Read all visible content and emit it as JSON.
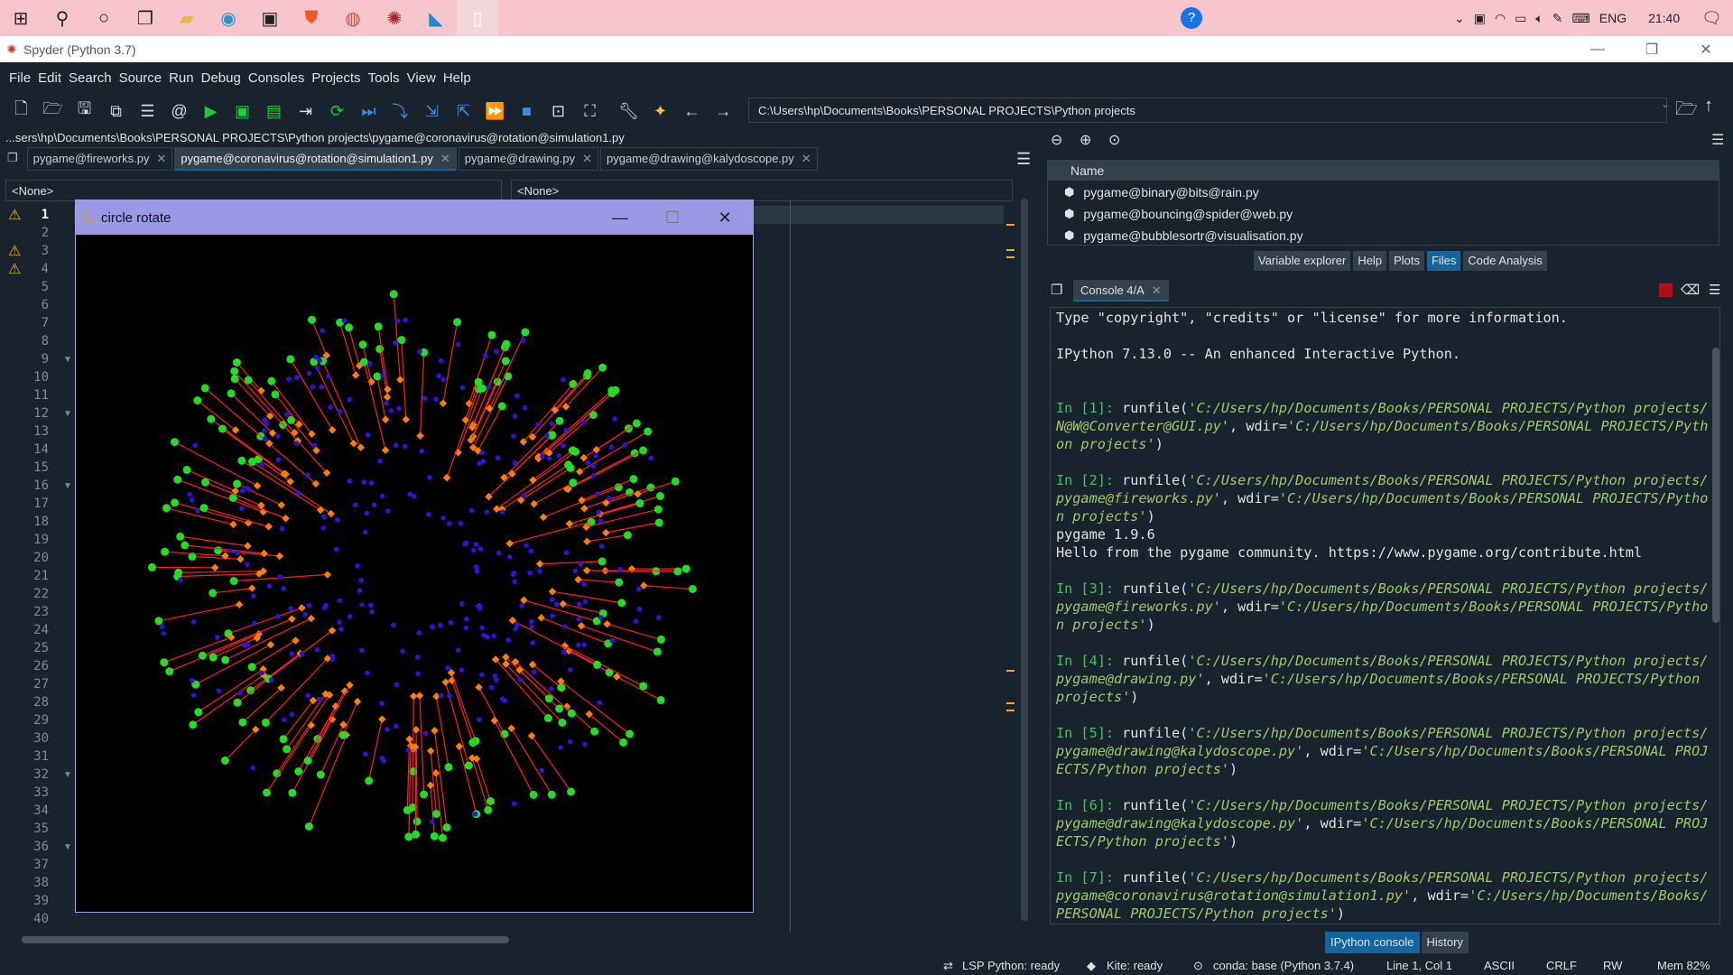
{
  "taskbar": {
    "icons": [
      "windows-start-icon",
      "search-icon",
      "cortana-icon",
      "task-view-icon",
      "file-explorer-icon",
      "edge-icon",
      "store-icon",
      "brave-icon",
      "chrome-icon",
      "spyder-taskbar-icon",
      "vscode-icon",
      "notepad-icon"
    ],
    "language": "ENG",
    "time": "21:40"
  },
  "window": {
    "title": "Spyder (Python 3.7)"
  },
  "menu": [
    "File",
    "Edit",
    "Search",
    "Source",
    "Run",
    "Debug",
    "Consoles",
    "Projects",
    "Tools",
    "View",
    "Help"
  ],
  "toolbar": {
    "working_dir": "C:\\Users\\hp\\Documents\\Books\\PERSONAL PROJECTS\\Python projects"
  },
  "editor": {
    "path": "...sers\\hp\\Documents\\Books\\PERSONAL PROJECTS\\Python projects\\pygame@coronavirus@rotation@simulation1.py",
    "tabs": [
      {
        "label": "pygame@fireworks.py",
        "active": false
      },
      {
        "label": "pygame@coronavirus@rotation@simulation1.py",
        "active": true
      },
      {
        "label": "pygame@drawing.py",
        "active": false
      },
      {
        "label": "pygame@drawing@kalydoscope.py",
        "active": false
      }
    ],
    "class_combo": "<None>",
    "method_combo": "<None>",
    "current_line": 1,
    "line_count": 40,
    "warning_lines": [
      1,
      3,
      4
    ],
    "fold_lines": [
      9,
      12,
      16,
      32,
      36
    ]
  },
  "pygame_window": {
    "title": "circle rotate"
  },
  "files": {
    "header": "Name",
    "items": [
      "pygame@binary@bits@rain.py",
      "pygame@bouncing@spider@web.py",
      "pygame@bubblesortr@visualisation.py"
    ]
  },
  "pane_tabs": [
    "Variable explorer",
    "Help",
    "Plots",
    "Files",
    "Code Analysis"
  ],
  "active_pane_tab": "Files",
  "console": {
    "tab": "Console 4/A",
    "intro1": "Type \"copyright\", \"credits\" or \"license\" for more information.",
    "intro2": "IPython 7.13.0 -- An enhanced Interactive Python.",
    "pygame_version": "pygame 1.9.6",
    "pygame_hello": "Hello from the pygame community. https://www.pygame.org/contribute.html",
    "entries": [
      {
        "prompt": "In [1]:",
        "file": "'C:/Users/hp/Documents/Books/PERSONAL PROJECTS/Python projects/N@W@Converter@GUI.py'",
        "wdir": "'C:/Users/hp/Documents/Books/PERSONAL PROJECTS/Python projects'"
      },
      {
        "prompt": "In [2]:",
        "file": "'C:/Users/hp/Documents/Books/PERSONAL PROJECTS/Python projects/pygame@fireworks.py'",
        "wdir": "'C:/Users/hp/Documents/Books/PERSONAL PROJECTS/Python projects'"
      },
      {
        "prompt": "In [3]:",
        "file": "'C:/Users/hp/Documents/Books/PERSONAL PROJECTS/Python projects/pygame@fireworks.py'",
        "wdir": "'C:/Users/hp/Documents/Books/PERSONAL PROJECTS/Python projects'"
      },
      {
        "prompt": "In [4]:",
        "file": "'C:/Users/hp/Documents/Books/PERSONAL PROJECTS/Python projects/pygame@drawing.py'",
        "wdir": "'C:/Users/hp/Documents/Books/PERSONAL PROJECTS/Python projects'"
      },
      {
        "prompt": "In [5]:",
        "file": "'C:/Users/hp/Documents/Books/PERSONAL PROJECTS/Python projects/pygame@drawing@kalydoscope.py'",
        "wdir": "'C:/Users/hp/Documents/Books/PERSONAL PROJECTS/Python projects'"
      },
      {
        "prompt": "In [6]:",
        "file": "'C:/Users/hp/Documents/Books/PERSONAL PROJECTS/Python projects/pygame@drawing@kalydoscope.py'",
        "wdir": "'C:/Users/hp/Documents/Books/PERSONAL PROJECTS/Python projects'"
      },
      {
        "prompt": "In [7]:",
        "file": "'C:/Users/hp/Documents/Books/PERSONAL PROJECTS/Python projects/pygame@coronavirus@rotation@simulation1.py'",
        "wdir": "'C:/Users/hp/Documents/Books/PERSONAL PROJECTS/Python projects'"
      }
    ]
  },
  "bottom_tabs": [
    "IPython console",
    "History"
  ],
  "status": {
    "lsp": "LSP Python: ready",
    "kite": "Kite: ready",
    "conda": "conda: base (Python 3.7.4)",
    "position": "Line 1, Col 1",
    "encoding": "ASCII",
    "eol": "CRLF",
    "permissions": "RW",
    "memory": "Mem 82%"
  },
  "colors": {
    "background": "#19232d",
    "accent": "#1464a0",
    "prompt": "#3ec45a",
    "string": "#9ec96a",
    "warning": "#f5a623",
    "particle_outer": "#22dd22",
    "particle_mid": "#ff7f00",
    "particle_inner": "#3311dd",
    "particle_line": "#ff2020"
  }
}
